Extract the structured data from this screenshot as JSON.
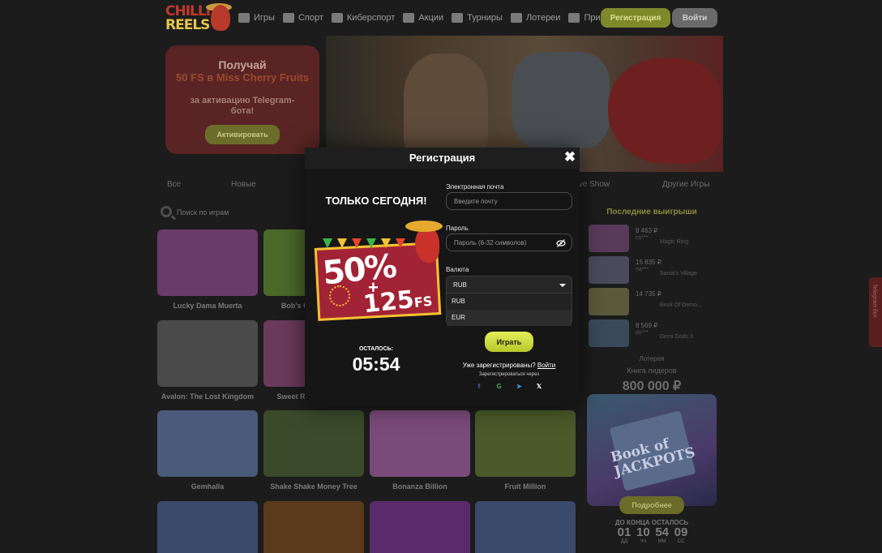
{
  "header": {
    "logo_line1": "CHILLI",
    "logo_line2": "REELS",
    "nav": [
      {
        "label": "Игры",
        "icon": "games-icon"
      },
      {
        "label": "Спорт",
        "icon": "sport-icon"
      },
      {
        "label": "Киберспорт",
        "icon": "gamepad-icon"
      },
      {
        "label": "Акции",
        "icon": "promo-icon"
      },
      {
        "label": "Турниры",
        "icon": "trophy-icon"
      },
      {
        "label": "Лотереи",
        "icon": "diamond-icon"
      },
      {
        "label": "Приложение",
        "icon": "app-icon"
      }
    ],
    "register_label": "Регистрация",
    "login_label": "Войти"
  },
  "promo": {
    "line1": "Получай",
    "line2": "50 FS в Miss Cherry Fruits",
    "line3": "за активацию Telegram-бота!",
    "button": "Активировать"
  },
  "tabs": [
    "Все",
    "Новые",
    "Live Show",
    "Другие Игры"
  ],
  "search": {
    "placeholder": "Поиск по играм"
  },
  "games": [
    {
      "name": "Lucky Dama Muerta",
      "color": "#6a3a6a"
    },
    {
      "name": "Bob's Coffee Shop",
      "color": "#4a6a2a"
    },
    {
      "name": "",
      "color": "#3a2a3a"
    },
    {
      "name": "",
      "color": "#3a2a3a"
    },
    {
      "name": "Avalon: The Lost Kingdom",
      "color": "#4a4a4a"
    },
    {
      "name": "Sweet Rush Bonanza",
      "color": "#6a3a5a"
    },
    {
      "name": "",
      "color": "#3a2a3a"
    },
    {
      "name": "",
      "color": "#3a2a3a"
    },
    {
      "name": "Gemhalla",
      "color": "#4a5a7a"
    },
    {
      "name": "Shake Shake Money Tree",
      "color": "#3a4a2a"
    },
    {
      "name": "Bonanza Billion",
      "color": "#7a4a7a"
    },
    {
      "name": "Fruit Million",
      "color": "#4a5a2a"
    },
    {
      "name": "",
      "color": "#3a4a6a"
    },
    {
      "name": "",
      "color": "#5a3a1a"
    },
    {
      "name": "",
      "color": "#5a2a6a"
    },
    {
      "name": "",
      "color": "#3a4a6a"
    }
  ],
  "wins": {
    "title": "Последние выигрыши",
    "items": [
      {
        "amount": "8 463 ₽",
        "user": "ns***",
        "game": "Magic Ring",
        "color": "#5a3a5a"
      },
      {
        "amount": "15 835 ₽",
        "user": "na***",
        "game": "Santa's Village",
        "color": "#4a4a5a"
      },
      {
        "amount": "14 735 ₽",
        "user": "",
        "game": "Book Of Demo...",
        "color": "#5a5a3a"
      },
      {
        "amount": "8 569 ₽",
        "user": "dv***",
        "game": "Demi Gods 3",
        "color": "#3a4a5a"
      }
    ]
  },
  "leaderboard": {
    "category": "Лотерея",
    "title": "Книга лидеров",
    "prize": "800 000 ₽",
    "banner_text": "Book of JACKPOTS",
    "button": "Подробнее",
    "countdown_label": "ДО КОНЦА ОСТАЛОСЬ",
    "countdown": [
      {
        "value": "01",
        "unit": "ДД"
      },
      {
        "value": "10",
        "unit": "ЧЧ"
      },
      {
        "value": "54",
        "unit": "ММ"
      },
      {
        "value": "09",
        "unit": "СС"
      }
    ]
  },
  "side_tab": "Telegram бот",
  "modal": {
    "title": "Регистрация",
    "today": "ТОЛЬКО СЕГОДНЯ!",
    "bonus_pct": "50%",
    "bonus_plus": "+",
    "bonus_fs_num": "125",
    "bonus_fs_unit": "FS",
    "timer_label": "ОСТАЛОСЬ:",
    "timer": "05:54",
    "email_label": "Электронная почта",
    "email_placeholder": "Введите почту",
    "password_label": "Пароль",
    "password_placeholder": "Пароль (6-32 символов)",
    "currency_label": "Валюта",
    "currency_value": "RUB",
    "currency_options": [
      "RUB",
      "EUR"
    ],
    "play_button": "Играть",
    "already_text": "Уже зарегистрированы?",
    "login_link": "Войти",
    "via_text": "Зарегистрироваться через",
    "socials": [
      {
        "icon": "facebook-icon",
        "glyph": "f",
        "color": "#3b6fd8"
      },
      {
        "icon": "google-icon",
        "glyph": "G",
        "color": "#4caf50"
      },
      {
        "icon": "telegram-icon",
        "glyph": "➤",
        "color": "#3aa2e0"
      },
      {
        "icon": "x-icon",
        "glyph": "𝕏",
        "color": "#ffffff"
      }
    ]
  }
}
